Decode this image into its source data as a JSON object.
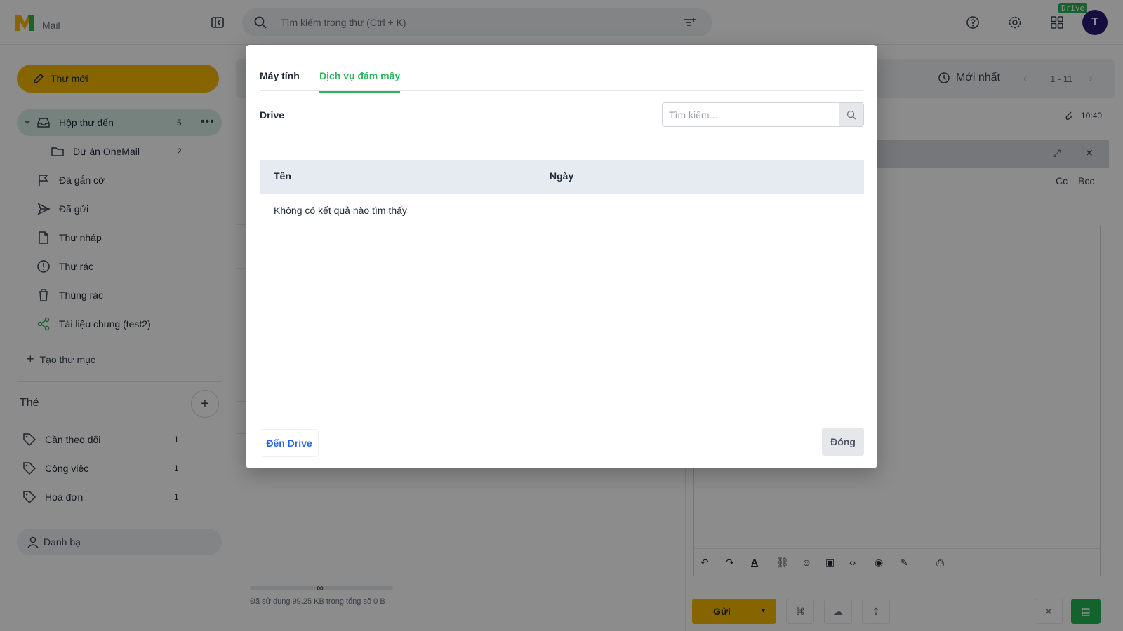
{
  "app": {
    "title": "Mail",
    "drive_badge": "Drive",
    "avatar_initial": "T",
    "accent": "#f5b800",
    "brand_green": "#2fb45a"
  },
  "search": {
    "placeholder": "Tìm kiếm trong thư (Ctrl + K)"
  },
  "sidebar": {
    "compose_label": "Thư mới",
    "items": [
      {
        "label": "Hộp thư đến",
        "count": "5",
        "icon": "inbox-icon",
        "active": true
      },
      {
        "label": "Dự án OneMail",
        "count": "2",
        "icon": "folder-icon",
        "sub": true
      },
      {
        "label": "Đã gắn cờ",
        "icon": "flag-icon"
      },
      {
        "label": "Đã gửi",
        "icon": "send-icon"
      },
      {
        "label": "Thư nháp",
        "icon": "draft-icon"
      },
      {
        "label": "Thư rác",
        "icon": "spam-icon"
      },
      {
        "label": "Thùng rác",
        "icon": "trash-icon"
      },
      {
        "label": "Tài liệu chung (test2)",
        "icon": "share-icon"
      }
    ],
    "create_folder_label": "Tạo thư mục",
    "tags_title": "Thẻ",
    "tags": [
      {
        "label": "Cần theo dõi",
        "count": "1"
      },
      {
        "label": "Công việc",
        "count": "1"
      },
      {
        "label": "Hoá đơn",
        "count": "1"
      }
    ],
    "contacts_label": "Danh bạ"
  },
  "mail_list": {
    "sort_label": "Mới nhất",
    "page_info": "1 - 11",
    "first_row_time": "10:40",
    "storage_infinity": "∞",
    "storage_text": "Đã sử dụng 99.25 KB trong tổng số 0 B"
  },
  "compose_window": {
    "cc_label": "Cc",
    "bcc_label": "Bcc",
    "send_label": "Gửi"
  },
  "modal": {
    "tabs": [
      {
        "label": "Máy tính",
        "active": false
      },
      {
        "label": "Dịch vụ đám mây",
        "active": true
      }
    ],
    "section_title": "Drive",
    "search_placeholder": "Tìm kiếm...",
    "columns": [
      "Tên",
      "Ngày"
    ],
    "empty_message": "Không có kết quả nào tìm thấy",
    "goto_drive_label": "Đến Drive",
    "close_label": "Đóng"
  }
}
